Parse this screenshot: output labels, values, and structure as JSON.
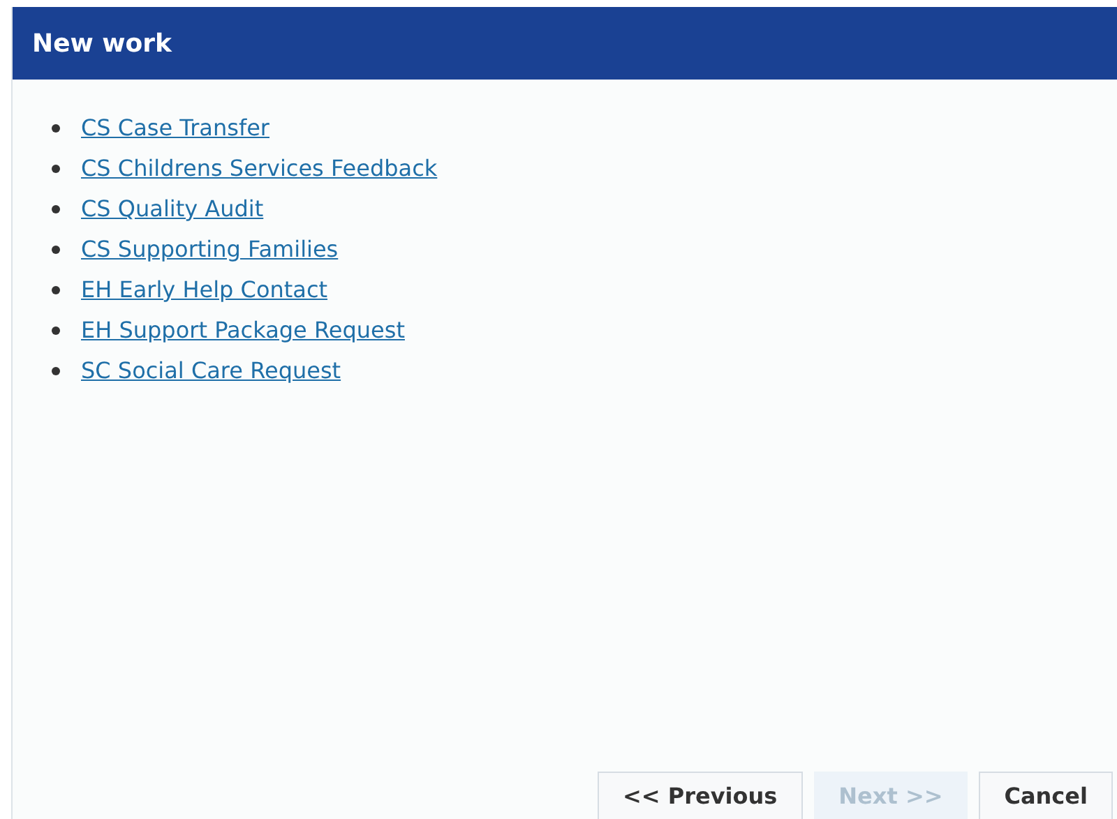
{
  "header": {
    "title": "New work"
  },
  "links": [
    {
      "label": "CS Case Transfer"
    },
    {
      "label": "CS Childrens Services Feedback"
    },
    {
      "label": "CS Quality Audit"
    },
    {
      "label": "CS Supporting Families"
    },
    {
      "label": "EH Early Help Contact"
    },
    {
      "label": "EH Support Package Request"
    },
    {
      "label": "SC Social Care Request"
    }
  ],
  "buttons": [
    {
      "label": "<< Previous",
      "disabled": false
    },
    {
      "label": "Next >>",
      "disabled": true
    },
    {
      "label": "Cancel",
      "disabled": false
    }
  ]
}
